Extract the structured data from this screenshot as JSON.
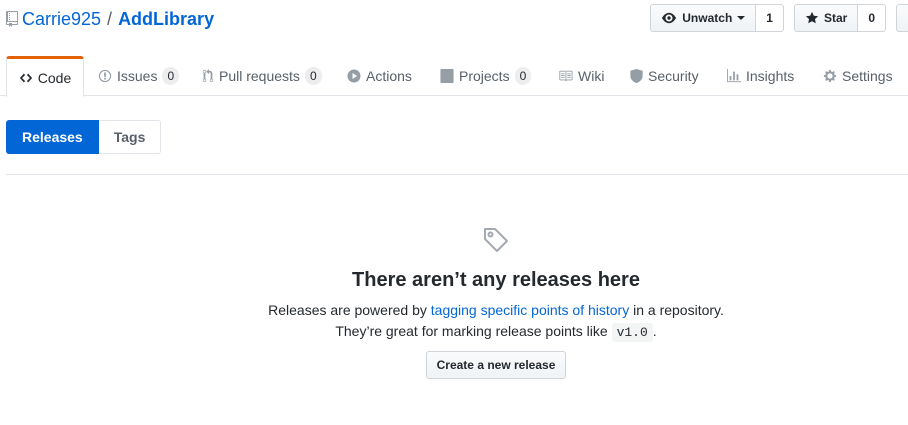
{
  "repo": {
    "owner": "Carrie925",
    "separator": "/",
    "name": "AddLibrary"
  },
  "actions": {
    "watch": {
      "label": "Unwatch",
      "count": "1"
    },
    "star": {
      "label": "Star",
      "count": "0"
    }
  },
  "tabs": [
    {
      "label": "Code",
      "counter": null
    },
    {
      "label": "Issues",
      "counter": "0"
    },
    {
      "label": "Pull requests",
      "counter": "0"
    },
    {
      "label": "Actions",
      "counter": null
    },
    {
      "label": "Projects",
      "counter": "0"
    },
    {
      "label": "Wiki",
      "counter": null
    },
    {
      "label": "Security",
      "counter": null
    },
    {
      "label": "Insights",
      "counter": null
    },
    {
      "label": "Settings",
      "counter": null
    }
  ],
  "subnav": {
    "releases": "Releases",
    "tags": "Tags"
  },
  "blankslate": {
    "title": "There aren’t any releases here",
    "line1_prefix": "Releases are powered by ",
    "line1_link": "tagging specific points of history",
    "line1_suffix": " in a repository.",
    "line2_prefix": "They’re great for marking release points like ",
    "line2_code": "v1.0",
    "line2_suffix": ".",
    "button": "Create a new release"
  },
  "colors": {
    "accent": "#0366d6",
    "tab_underline": "#e36209"
  }
}
